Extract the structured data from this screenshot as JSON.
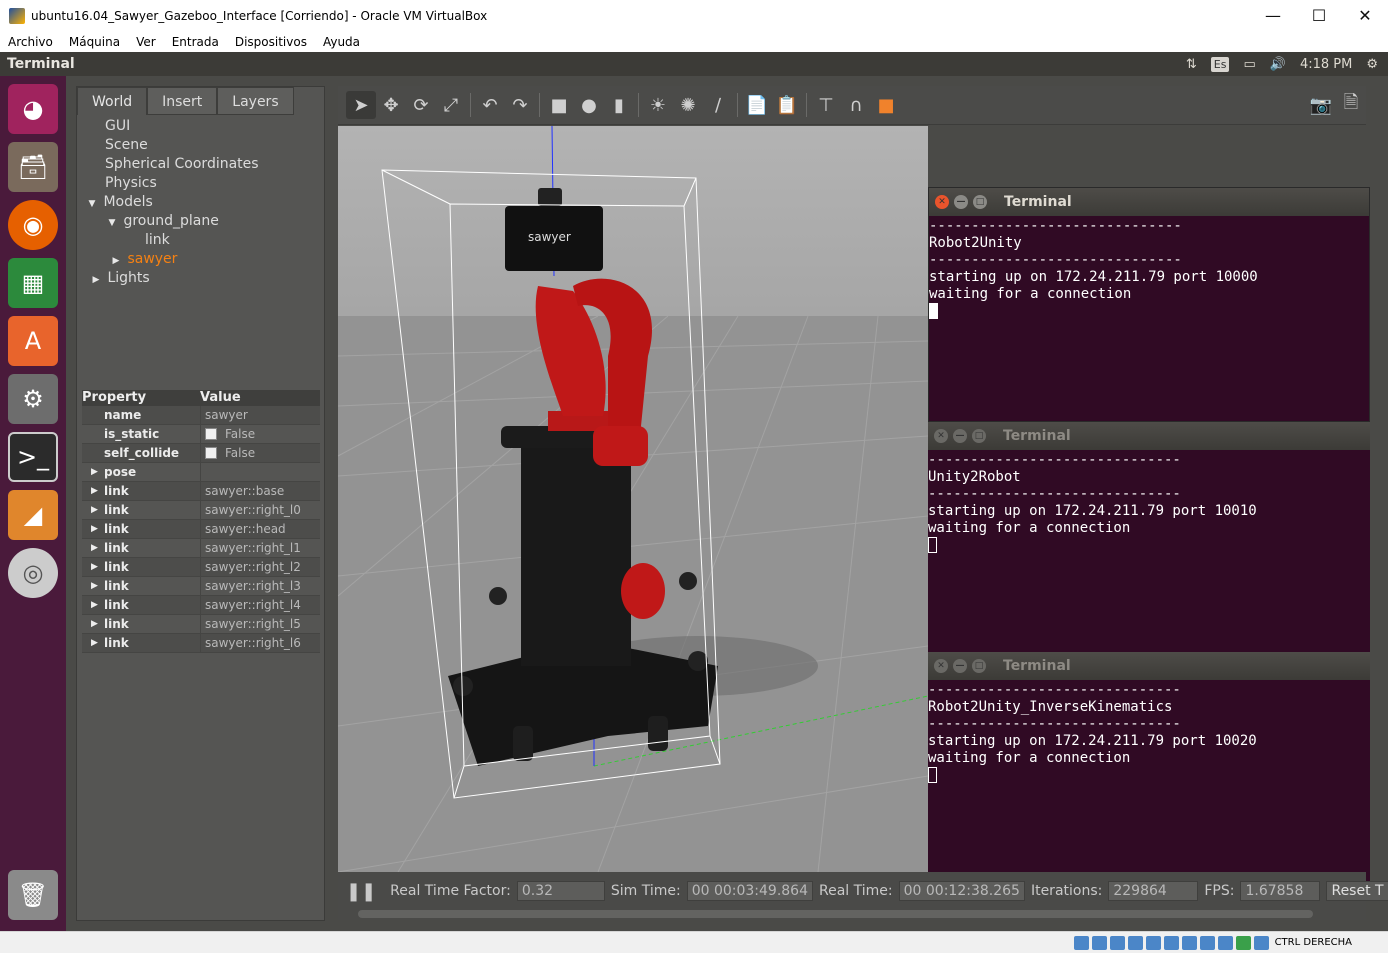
{
  "window": {
    "title": "ubuntu16.04_Sawyer_Gazeboo_Interface [Corriendo] - Oracle VM VirtualBox",
    "menu": [
      "Archivo",
      "Máquina",
      "Ver",
      "Entrada",
      "Dispositivos",
      "Ayuda"
    ],
    "host_key": "CTRL DERECHA"
  },
  "topbar": {
    "title": "Terminal",
    "keyboard": "Es",
    "time": "4:18 PM"
  },
  "launcher": {
    "items": [
      "ubuntu-dash-icon",
      "files-icon",
      "firefox-icon",
      "calc-spreadsheet-icon",
      "software-center-icon",
      "system-settings-icon",
      "terminal-icon",
      "gazebo-icon",
      "dvd-icon",
      "trash-icon"
    ]
  },
  "gazebo": {
    "tabs": [
      "World",
      "Insert",
      "Layers"
    ],
    "tree": {
      "gui": "GUI",
      "scene": "Scene",
      "spherical": "Spherical Coordinates",
      "physics": "Physics",
      "models": "Models",
      "ground_plane": "ground_plane",
      "link": "link",
      "sawyer": "sawyer",
      "lights": "Lights"
    },
    "props_header": {
      "property": "Property",
      "value": "Value"
    },
    "props": [
      {
        "k": "name",
        "v": "sawyer"
      },
      {
        "k": "is_static",
        "v": "False"
      },
      {
        "k": "self_collide",
        "v": "False"
      },
      {
        "k": "pose",
        "v": ""
      },
      {
        "k": "link",
        "v": "sawyer::base"
      },
      {
        "k": "link",
        "v": "sawyer::right_l0"
      },
      {
        "k": "link",
        "v": "sawyer::head"
      },
      {
        "k": "link",
        "v": "sawyer::right_l1"
      },
      {
        "k": "link",
        "v": "sawyer::right_l2"
      },
      {
        "k": "link",
        "v": "sawyer::right_l3"
      },
      {
        "k": "link",
        "v": "sawyer::right_l4"
      },
      {
        "k": "link",
        "v": "sawyer::right_l5"
      },
      {
        "k": "link",
        "v": "sawyer::right_l6"
      }
    ],
    "bottom": {
      "rtf_label": "Real Time Factor:",
      "rtf": "0.32",
      "sim_label": "Sim Time:",
      "sim": "00 00:03:49.864",
      "real_label": "Real Time:",
      "real": "00 00:12:38.265",
      "iter_label": "Iterations:",
      "iter": "229864",
      "fps_label": "FPS:",
      "fps": "1.67858",
      "reset": "Reset T"
    }
  },
  "terminals": [
    {
      "title": "Terminal",
      "sep": "------------------------------",
      "name": "Robot2Unity",
      "line1": "starting up on 172.24.211.79 port 10000",
      "line2": "waiting for a connection"
    },
    {
      "title": "Terminal",
      "sep": "------------------------------",
      "name": "Unity2Robot",
      "line1": "starting up on 172.24.211.79 port 10010",
      "line2": "waiting for a connection"
    },
    {
      "title": "Terminal",
      "sep": "------------------------------",
      "name": "Robot2Unity_InverseKinematics",
      "line1": "starting up on 172.24.211.79 port 10020",
      "line2": "waiting for a connection"
    }
  ],
  "robot_screen_text": "sawyer"
}
